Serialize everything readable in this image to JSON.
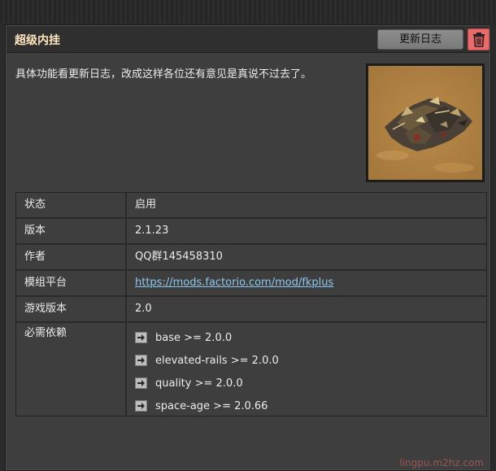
{
  "mod": {
    "title": "超级内挂",
    "changelog_button": "更新日志",
    "delete_icon": "trash-icon",
    "description": "具体功能看更新日志，改成这样各位还有意见是真说不过去了。"
  },
  "details": [
    {
      "label": "状态",
      "value": "启用"
    },
    {
      "label": "版本",
      "value": "2.1.23"
    },
    {
      "label": "作者",
      "value": "QQ群145458310"
    },
    {
      "label": "模组平台",
      "value": "https://mods.factorio.com/mod/fkplus"
    },
    {
      "label": "游戏版本",
      "value": "2.0"
    }
  ],
  "dependencies": {
    "label": "必需依赖",
    "items": [
      "base >= 2.0.0",
      "elevated-rails >= 2.0.0",
      "quality >= 2.0.0",
      "space-age >= 2.0.66"
    ]
  },
  "watermark": "lingpu.m2hz.com",
  "colors": {
    "title": "#ffe6c0",
    "delete_button": "#e76b6b",
    "link": "#8cc8f0"
  }
}
